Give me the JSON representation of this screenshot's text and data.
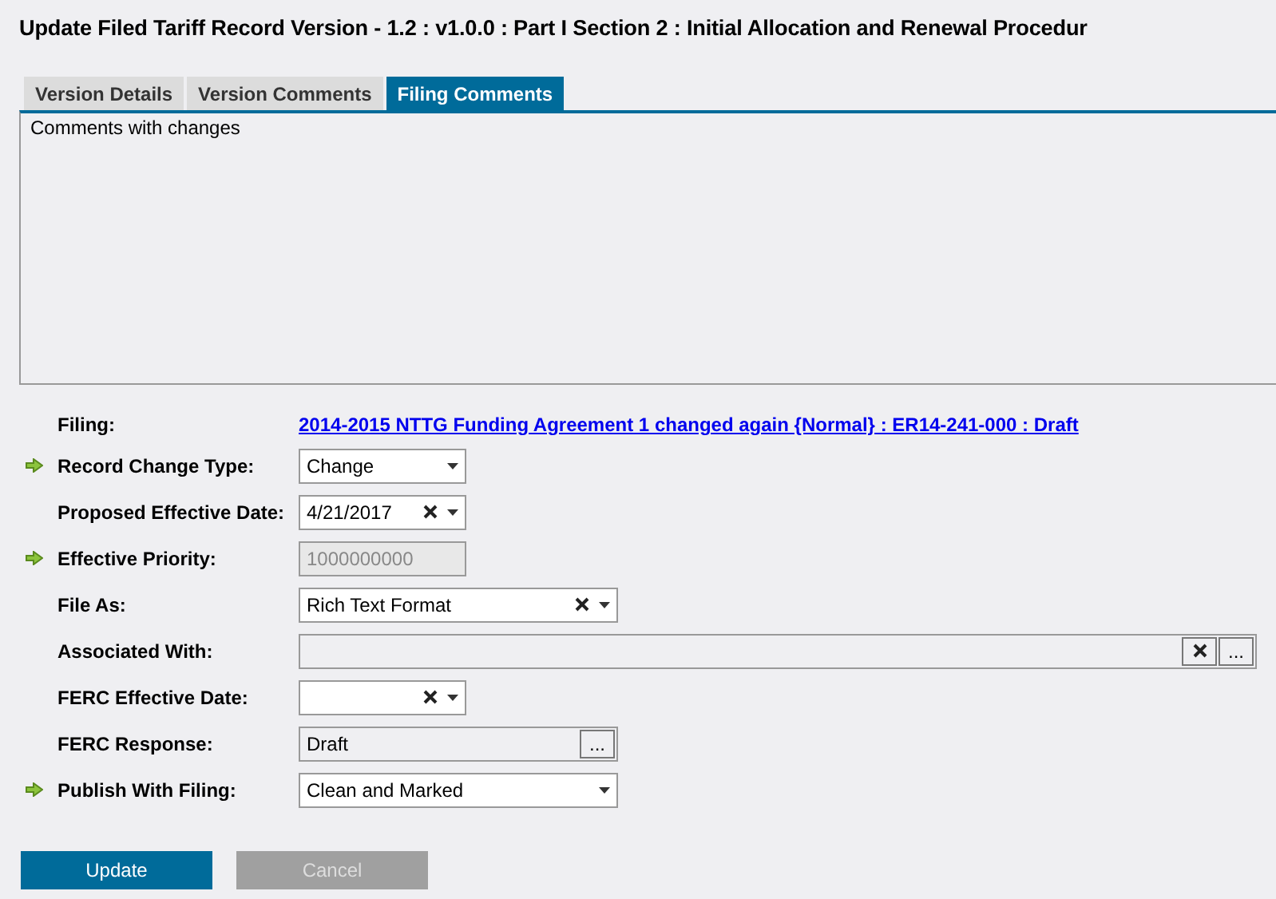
{
  "window": {
    "title": "Update Filed Tariff Record Version - 1.2 : v1.0.0 : Part I Section 2 : Initial Allocation and Renewal Procedur"
  },
  "tabs": [
    {
      "label": "Version Details",
      "selected": false
    },
    {
      "label": "Version Comments",
      "selected": false
    },
    {
      "label": "Filing Comments",
      "selected": true
    }
  ],
  "comments": {
    "value": "Comments with changes"
  },
  "fields": [
    {
      "label": "Filing:",
      "kind": "link",
      "required": false,
      "value": "2014-2015 NTTG Funding Agreement 1 changed again {Normal} : ER14-241-000 : Draft"
    },
    {
      "label": "Record Change Type:",
      "kind": "dropdown",
      "required": true,
      "value": "Change",
      "clearable": false
    },
    {
      "label": "Proposed Effective Date:",
      "kind": "dropdown",
      "required": false,
      "value": "4/21/2017",
      "clearable": true
    },
    {
      "label": "Effective Priority:",
      "kind": "readonly",
      "required": true,
      "value": "1000000000"
    },
    {
      "label": "File As:",
      "kind": "dropdown",
      "required": false,
      "value": "Rich Text Format",
      "clearable": true
    },
    {
      "label": "Associated With:",
      "kind": "lookup",
      "required": false,
      "clearable": true,
      "browse": "..."
    },
    {
      "label": "FERC Effective Date:",
      "kind": "dropdown",
      "required": false,
      "clearable": true
    },
    {
      "label": "FERC Response:",
      "kind": "lookup",
      "required": false,
      "value": "Draft",
      "clearable": false,
      "browse": "..."
    },
    {
      "label": "Publish With Filing:",
      "kind": "dropdown",
      "required": true,
      "value": "Clean and Marked",
      "clearable": false
    }
  ],
  "buttons": [
    {
      "label": "Update",
      "disabled": false
    },
    {
      "label": "Cancel",
      "disabled": true
    }
  ]
}
